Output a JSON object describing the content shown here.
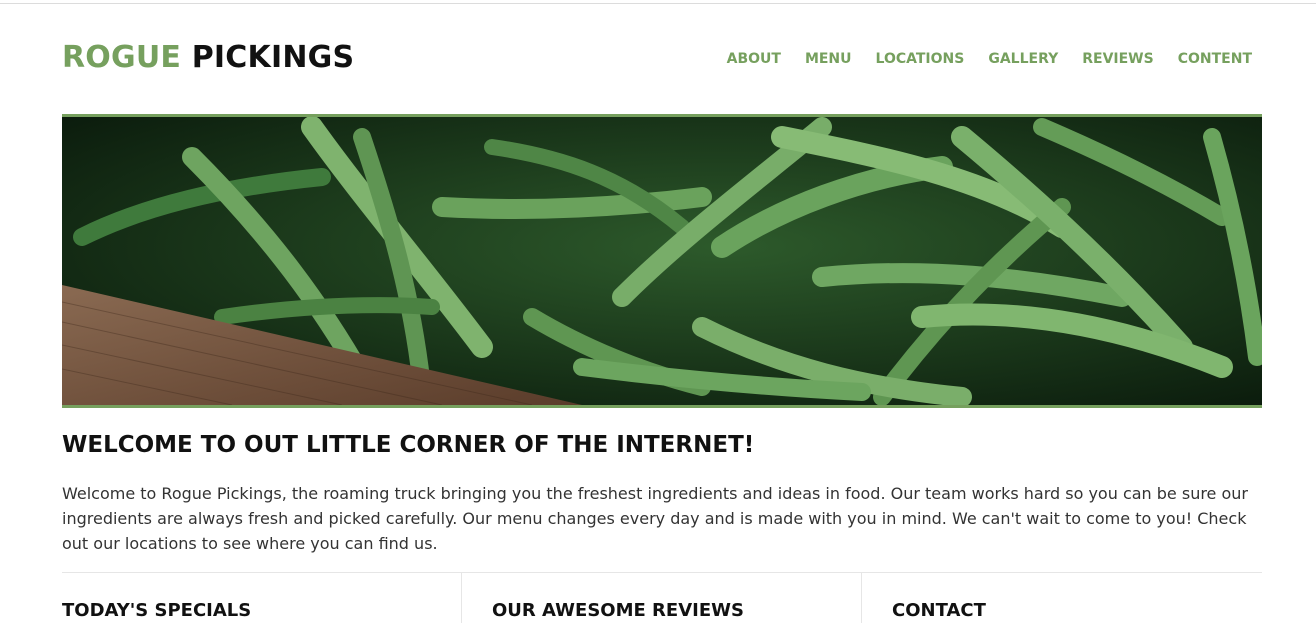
{
  "brand": {
    "part1": "ROGUE",
    "part2": "PICKINGS"
  },
  "nav": {
    "items": [
      {
        "label": "ABOUT"
      },
      {
        "label": "MENU"
      },
      {
        "label": "LOCATIONS"
      },
      {
        "label": "GALLERY"
      },
      {
        "label": "REVIEWS"
      },
      {
        "label": "CONTENT"
      }
    ]
  },
  "colors": {
    "accent": "#76a05e",
    "text": "#111111"
  },
  "welcome": {
    "title": "WELCOME TO OUT LITTLE CORNER OF THE INTERNET!",
    "body": "Welcome to Rogue Pickings, the roaming truck bringing you the freshest ingredients and ideas in food. Our team works hard so you can be sure our ingredients are always fresh and picked carefully. Our menu changes every day and is made with you in mind. We can't wait to come to you! Check out our locations to see where you can find us."
  },
  "columns": [
    {
      "heading": "TODAY'S SPECIALS"
    },
    {
      "heading": "OUR AWESOME REVIEWS"
    },
    {
      "heading": "CONTACT"
    }
  ]
}
